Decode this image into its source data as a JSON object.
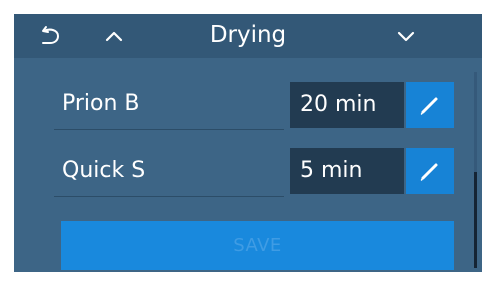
{
  "header": {
    "title": "Drying",
    "back_icon": "undo-arrow-icon",
    "up_icon": "chevron-up-icon",
    "down_icon": "chevron-down-icon"
  },
  "rows": [
    {
      "label": "Prion B",
      "value": "20 min",
      "edit_icon": "pencil-icon"
    },
    {
      "label": "Quick S",
      "value": "5 min",
      "edit_icon": "pencil-icon"
    }
  ],
  "save_label": "SAVE",
  "colors": {
    "screen_bg": "#3d6586",
    "header_bg": "#335877",
    "value_bg": "#223b51",
    "accent": "#1783d6"
  }
}
